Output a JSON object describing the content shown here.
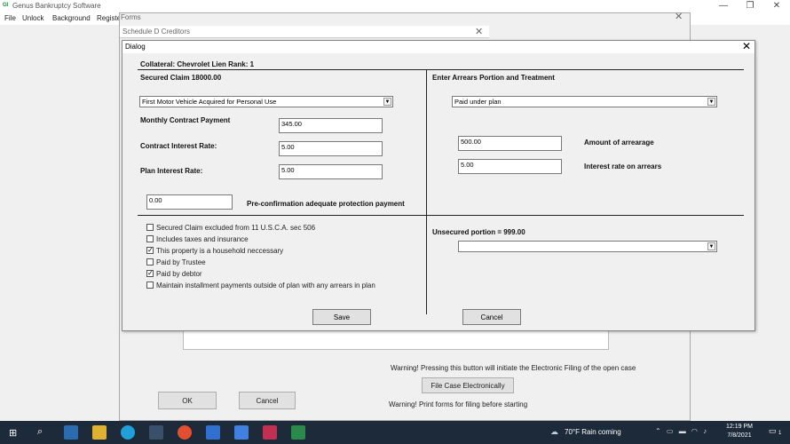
{
  "app": {
    "title": "Genus Bankruptcy Software",
    "menu": [
      "File",
      "Unlock",
      "Background",
      "Registe"
    ],
    "window_controls": [
      "—",
      "❐",
      "✕"
    ]
  },
  "forms_window": {
    "title": "Forms",
    "schedule_title": "Schedule D Creditors",
    "warning_efile": "Warning! Pressing this button will initiate the Electronic Filing of the open case",
    "efile_button": "File Case Electronically",
    "warning_print": "Warning! Print forms for filing before starting",
    "ok_button": "OK",
    "cancel_button": "Cancel"
  },
  "dialog": {
    "title": "Dialog",
    "collateral": "Collateral: Chevrolet Lien Rank: 1",
    "secured_claim": "Secured Claim 18000.00",
    "arrears_heading": "Enter Arrears Portion and Treatment",
    "property_type": "First Motor Vehicle Acquired for Personal Use",
    "monthly_label": "Monthly Contract Payment",
    "monthly_value": "345.00",
    "contract_rate_label": "Contract Interest Rate:",
    "contract_rate_value": "5.00",
    "plan_rate_label": "Plan Interest Rate:",
    "plan_rate_value": "5.00",
    "preconf_value": "0.00",
    "preconf_label": "Pre-confirmation adequate protection payment",
    "arrears_treatment": "Paid under plan",
    "arrearage_value": "500.00",
    "arrearage_label": "Amount of arrearage",
    "arrears_rate_value": "5.00",
    "arrears_rate_label": "Interest rate on arrears",
    "unsecured_label": "Unsecured portion = 999.00",
    "unsecured_select": "",
    "checkboxes": [
      {
        "label": "Secured Claim excluded from 11 U.S.C.A. sec 506",
        "checked": false
      },
      {
        "label": "Includes taxes and insurance",
        "checked": false
      },
      {
        "label": "This property is a household neccessary",
        "checked": true
      },
      {
        "label": "Paid by Trustee",
        "checked": false
      },
      {
        "label": "Paid by debtor",
        "checked": true
      },
      {
        "label": "Maintain installment payments outside of plan with any arrears in plan",
        "checked": false
      }
    ],
    "save_button": "Save",
    "cancel_button": "Cancel"
  },
  "taskbar": {
    "weather": "70°F  Rain coming",
    "time": "12:19 PM",
    "date": "7/8/2021",
    "notification_count": "1"
  }
}
